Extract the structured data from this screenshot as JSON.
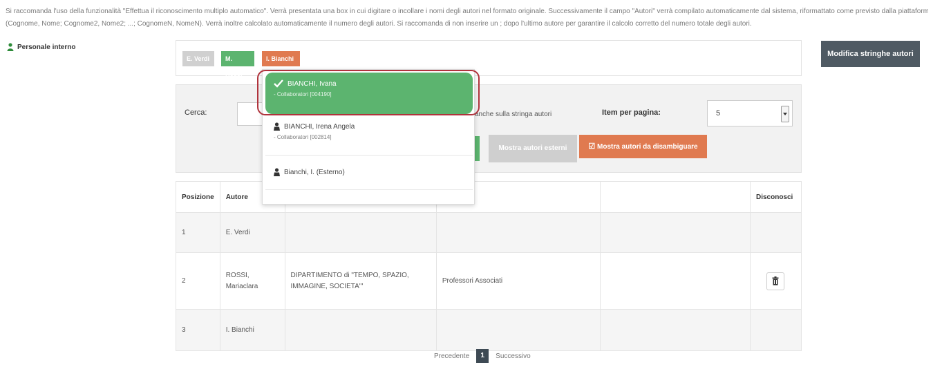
{
  "notice": {
    "line1": "Si raccomanda l'uso della funzionalità \"Effettua il riconoscimento multiplo automatico\". Verrà presentata una box in cui digitare o incollare i nomi degli autori nel formato originale. Successivamente il campo \"Autori\" verrà compilato automaticamente dal sistema, riformattato come previsto dalla piattaforma",
    "line2": "(Cognome, Nome; Cognome2, Nome2; ...; CognomeN, NomeN). Verrà inoltre calcolato automaticamente il numero degli autori. Si raccomanda di non inserire un ; dopo l'ultimo autore per garantire il calcolo corretto del numero totale degli autori."
  },
  "sidebar": {
    "staff_label": "Personale interno"
  },
  "chips": [
    {
      "label": "E. Verdi"
    },
    {
      "label": "M. Rossi"
    },
    {
      "label": "I. Bianchi"
    }
  ],
  "actions": {
    "edit_author_strings": "Modifica stringhe autori"
  },
  "search": {
    "label": "Cerca:",
    "value": "",
    "strings_hint": "anche sulla stringa autori",
    "per_page_label": "Item per pagina:",
    "per_page_value": "5",
    "show_external": "Mostra autori esterni",
    "show_disambiguate": "Mostra autori da disambiguare"
  },
  "dropdown": {
    "items": [
      {
        "name": "BIANCHI, Ivana",
        "sub": "- Collaboratori [004190]"
      },
      {
        "name": "BIANCHI, Irena Angela",
        "sub": "- Collaboratori [002814]"
      },
      {
        "name": "Bianchi, I. (Esterno)",
        "sub": ""
      }
    ]
  },
  "table": {
    "headers": {
      "position": "Posizione",
      "author": "Autore",
      "disown": "Disconosci"
    },
    "rows": [
      {
        "position": "1",
        "author": "E. Verdi",
        "department": "",
        "role": ""
      },
      {
        "position": "2",
        "author": "ROSSI, Mariaclara",
        "department": "DIPARTIMENTO di \"TEMPO, SPAZIO, IMMAGINE, SOCIETA'\"",
        "role": "Professori Associati"
      },
      {
        "position": "3",
        "author": "I. Bianchi",
        "department": "",
        "role": ""
      }
    ]
  },
  "pagination": {
    "previous": "Precedente",
    "current": "1",
    "next": "Successivo"
  },
  "colors": {
    "green": "#5cb46f",
    "orange": "#e07a50",
    "gray_chip": "#d0d0d0",
    "dark_button": "#4f5a63",
    "highlight_ring": "#b0333c"
  },
  "icons": [
    "user-icon",
    "check-icon",
    "person-icon",
    "checkbox-icon",
    "trash-icon",
    "caret-down-icon"
  ]
}
